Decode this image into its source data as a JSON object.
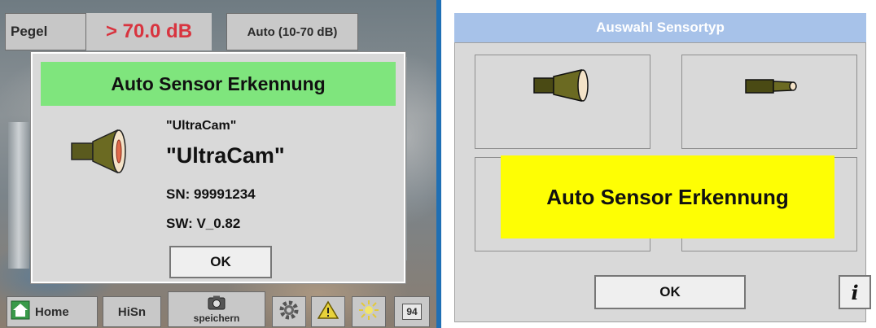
{
  "left_panel": {
    "top_bar": {
      "pegel_label": "Pegel",
      "pegel_value": "> 70.0 dB",
      "auto_range_label": "Auto (10-70 dB)"
    },
    "dialog": {
      "title": "Auto Sensor Erkennung",
      "name_small": "\"UltraCam\"",
      "name_large": "\"UltraCam\"",
      "serial": "SN: 99991234",
      "software": "SW: V_0.82",
      "ok_label": "OK",
      "sensor_icon": "ultracam-sensor-icon"
    },
    "bottom_bar": {
      "home_label": "Home",
      "hisn_label": "HiSn",
      "save_label": "speichern",
      "number_badge": "94",
      "icons": [
        "home-icon",
        "camera-icon",
        "gear-icon",
        "warning-icon",
        "brightness-icon"
      ]
    }
  },
  "right_panel": {
    "title": "Auswahl Sensortyp",
    "tiles": [
      {
        "label": "",
        "icon": "ultracam-sensor-icon"
      },
      {
        "label": "",
        "icon": "probe-sensor-icon"
      },
      {
        "label": "---",
        "icon": "no-sensor-icon"
      },
      {
        "label": "---",
        "icon": "no-sensor-icon"
      }
    ],
    "banner": "Auto Sensor Erkennung",
    "ok_label": "OK",
    "info_label": "i"
  },
  "colors": {
    "dialog_title_bg": "#7fe57d",
    "banner_bg": "#fefe04",
    "right_title_bg": "#a7c2e9",
    "pegel_value": "#d8343f",
    "divider": "#1f6fb4"
  }
}
